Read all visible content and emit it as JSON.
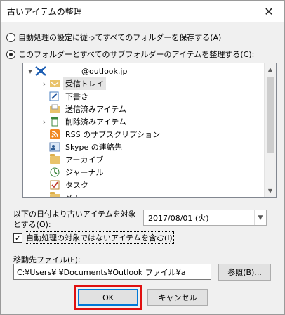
{
  "window": {
    "title": "古いアイテムの整理",
    "close_glyph": "✕"
  },
  "options": {
    "keep_all": "自動処理の設定に従ってすべてのフォルダーを保存する(A)",
    "archive_this": "このフォルダーとすべてのサブフォルダーのアイテムを整理する(C):"
  },
  "tree": {
    "items": [
      {
        "label": "@outlook.jp",
        "icon": "account-icon",
        "expander": "▾",
        "selected": false
      },
      {
        "label": "受信トレイ",
        "icon": "inbox-icon",
        "expander": "›",
        "selected": true
      },
      {
        "label": "下書き",
        "icon": "drafts-icon",
        "expander": "",
        "selected": false
      },
      {
        "label": "送信済みアイテム",
        "icon": "sent-icon",
        "expander": "",
        "selected": false
      },
      {
        "label": "削除済みアイテム",
        "icon": "trash-icon",
        "expander": "›",
        "selected": false
      },
      {
        "label": "RSS のサブスクリプション",
        "icon": "rss-icon",
        "expander": "",
        "selected": false
      },
      {
        "label": "Skype の連絡先",
        "icon": "contacts-icon",
        "expander": "",
        "selected": false
      },
      {
        "label": "アーカイブ",
        "icon": "folder-icon",
        "expander": "",
        "selected": false
      },
      {
        "label": "ジャーナル",
        "icon": "journal-icon",
        "expander": "",
        "selected": false
      },
      {
        "label": "タスク",
        "icon": "tasks-icon",
        "expander": "",
        "selected": false
      },
      {
        "label": "メモ",
        "icon": "folder-icon",
        "expander": "",
        "selected": false
      }
    ]
  },
  "date_filter": {
    "label": "以下の日付より古いアイテムを対象とする(O):",
    "value": "2017/08/01 (火)"
  },
  "include_option": {
    "label": "自動処理の対象ではないアイテムを含む(I)",
    "checked": true,
    "check_glyph": "✓"
  },
  "destination": {
    "label": "移動先ファイル(F):",
    "value": "C:¥Users¥      ¥Documents¥Outlook ファイル¥a",
    "browse_label": "参照(B)..."
  },
  "buttons": {
    "ok": "OK",
    "cancel": "キャンセル"
  },
  "colors": {
    "highlight": "#e01010",
    "default_button_border": "#0078d7"
  }
}
